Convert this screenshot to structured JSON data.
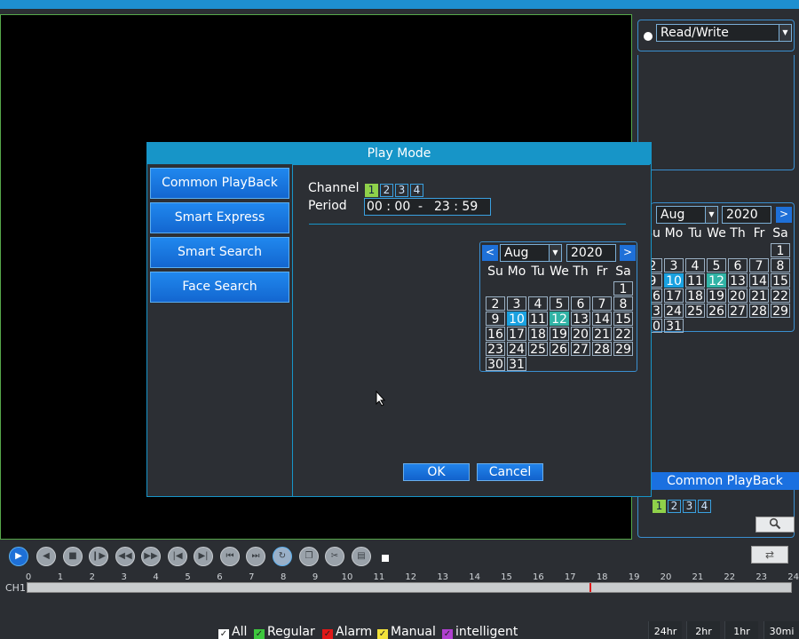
{
  "dialog": {
    "title": "Play Mode",
    "modes": [
      "Common PlayBack",
      "Smart Express",
      "Smart Search",
      "Face Search"
    ],
    "channel_label": "Channel",
    "channels": [
      "1",
      "2",
      "3",
      "4"
    ],
    "period_label": "Period",
    "period_start": "00 : 00",
    "period_sep": "-",
    "period_end": "23 : 59",
    "ok": "OK",
    "cancel": "Cancel",
    "calendar": {
      "prev": "<",
      "next": ">",
      "month": "Aug",
      "year": "2020",
      "weekdays": [
        "Su",
        "Mo",
        "Tu",
        "We",
        "Th",
        "Fr",
        "Sa"
      ],
      "recorded_day": "10",
      "selected_day": "12"
    }
  },
  "right_panel": {
    "mode": "Read/Write",
    "calendar": {
      "month": "Aug",
      "year": "2020",
      "next": ">"
    },
    "playback_mode": "Common PlayBack",
    "channels": [
      "1",
      "2",
      "3",
      "4"
    ],
    "search_icon": "magnifier-icon"
  },
  "timeline": {
    "channel": "CH1",
    "hours": [
      "0",
      "1",
      "2",
      "3",
      "4",
      "5",
      "6",
      "7",
      "8",
      "9",
      "10",
      "11",
      "12",
      "13",
      "14",
      "15",
      "16",
      "17",
      "18",
      "19",
      "20",
      "21",
      "22",
      "23",
      "24"
    ]
  },
  "legend": {
    "items": [
      {
        "label": "All",
        "color": "#ffffff"
      },
      {
        "label": "Regular",
        "color": "#3ec83e"
      },
      {
        "label": "Alarm",
        "color": "#e01818"
      },
      {
        "label": "Manual",
        "color": "#f2e23a"
      },
      {
        "label": "intelligent",
        "color": "#b040d0"
      }
    ],
    "zoom": [
      "24hr",
      "2hr",
      "1hr",
      "30mi"
    ]
  },
  "colors": {
    "accent": "#1795c8",
    "button": "#1a70e0",
    "recorded": "#1aa1e0",
    "selected": "#31b3a6"
  }
}
